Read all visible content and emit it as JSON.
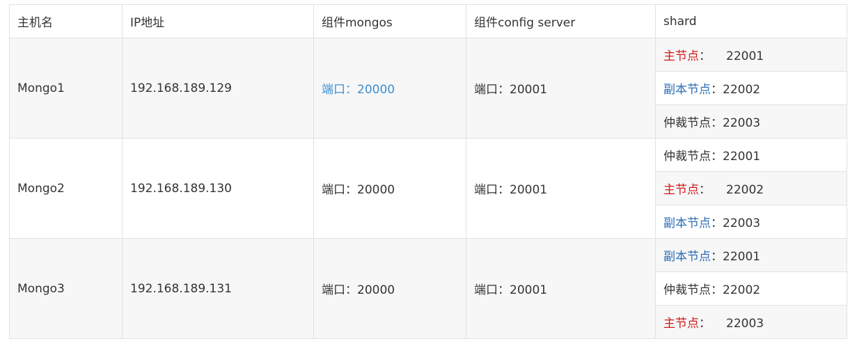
{
  "headers": [
    "主机名",
    "IP地址",
    "组件mongos",
    "组件config server",
    "shard"
  ],
  "rows": [
    {
      "host": "Mongo1",
      "ip": "192.168.189.129",
      "mongos": "端口：20000",
      "config": "端口：20001",
      "shards": [
        {
          "role": "主节点",
          "sep": "：",
          "port": "22001"
        },
        {
          "role": "副本节点",
          "sep": "：",
          "port": "22002"
        },
        {
          "role": "仲裁节点",
          "sep": "：",
          "port": "22003"
        }
      ]
    },
    {
      "host": "Mongo2",
      "ip": "192.168.189.130",
      "mongos": "端口：20000",
      "config": "端口：20001",
      "shards": [
        {
          "role": "仲裁节点",
          "sep": "：",
          "port": "22001"
        },
        {
          "role": "主节点",
          "sep": "：",
          "port": "22002"
        },
        {
          "role": "副本节点",
          "sep": "：",
          "port": "22003"
        }
      ]
    },
    {
      "host": "Mongo3",
      "ip": "192.168.189.131",
      "mongos": "端口：20000",
      "config": "端口：20001",
      "shards": [
        {
          "role": "副本节点",
          "sep": "：",
          "port": "22001"
        },
        {
          "role": "仲裁节点",
          "sep": "：",
          "port": "22002"
        },
        {
          "role": "主节点",
          "sep": "：",
          "port": "22003"
        }
      ]
    }
  ],
  "colors": {
    "primary_label": "#d11a1a",
    "secondary_label": "#2a6db5",
    "link_text": "#3d8fd1",
    "text": "#333333",
    "row_shade": "#f7f7f7",
    "border": "#e1e1e1"
  }
}
